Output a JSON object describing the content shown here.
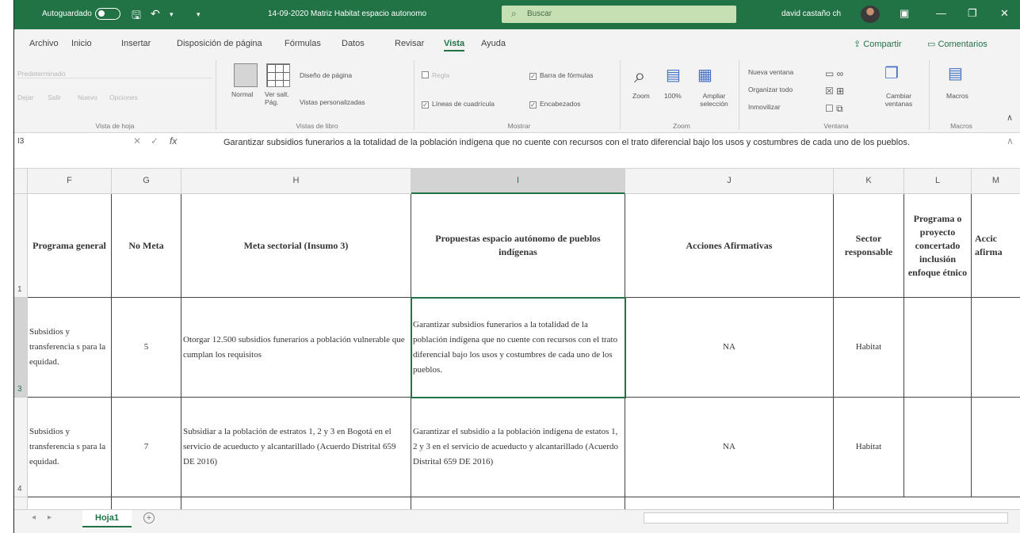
{
  "titlebar": {
    "autosave_label": "Autoguardado",
    "document_title": "14-09-2020 Matriz Habitat espacio autonomo",
    "search_placeholder": "Buscar",
    "user_name": "david castaño ch"
  },
  "tabs": [
    "Archivo",
    "Inicio",
    "Insertar",
    "Disposición de página",
    "Fórmulas",
    "Datos",
    "Revisar",
    "Vista",
    "Ayuda"
  ],
  "active_tab": "Vista",
  "share_label": "Compartir",
  "comments_label": "Comentarios",
  "ribbon": {
    "sheet_view": {
      "dropdown": "Predeterminado",
      "buttons": [
        "Dejar",
        "Salir",
        "Nuevo",
        "Opciones"
      ],
      "label": "Vista de hoja"
    },
    "workbook_views": {
      "normal": "Normal",
      "page_break": "Ver salt. Pág.",
      "page_layout": "Diseño de página",
      "custom": "Vistas personalizadas",
      "label": "Vistas de libro"
    },
    "show": {
      "ruler": "Regla",
      "formula_bar": "Barra de fórmulas",
      "gridlines": "Líneas de cuadrícula",
      "headings": "Encabezados",
      "label": "Mostrar"
    },
    "zoom": {
      "zoom": "Zoom",
      "hundred": "100%",
      "selection": "Ampliar selección",
      "label": "Zoom"
    },
    "window": {
      "new_window": "Nueva ventana",
      "arrange_all": "Organizar todo",
      "freeze": "Inmovilizar",
      "switch": "Cambiar ventanas",
      "label": "Ventana"
    },
    "macros": {
      "macros": "Macros",
      "label": "Macros"
    }
  },
  "formula_bar": {
    "name_box": "I3",
    "content": "Garantizar subsidios funerarios a la totalidad de la población indígena que no cuente con recursos con el trato diferencial bajo los usos y costumbres de cada uno de los pueblos."
  },
  "columns": [
    "F",
    "G",
    "H",
    "I",
    "J",
    "K",
    "L",
    "M"
  ],
  "rows": [
    "1",
    "3",
    "4"
  ],
  "header_row": {
    "F": "Programa general",
    "G": "No Meta",
    "H": "Meta sectorial (Insumo 3)",
    "I": "Propuestas espacio autónomo de pueblos indígenas",
    "J": "Acciones Afirmativas",
    "K": "Sector responsable",
    "L": "Programa o proyecto concertado inclusión enfoque étnico",
    "M": "Accic afirma"
  },
  "row3": {
    "F": "Subsidios y transferencia s para la equidad.",
    "G": "5",
    "H": "Otorgar 12.500 subsidios funerarios a población vulnerable que cumplan los requisitos",
    "I": "Garantizar subsidios funerarios a la totalidad de la población indígena que no cuente con recursos con el trato diferencial bajo los usos y costumbres de cada uno de los pueblos.",
    "J": "NA",
    "K": "Habitat"
  },
  "row4": {
    "F": "Subsidios y transferencia s para la equidad.",
    "G": "7",
    "H": "Subsidiar a la población de estratos 1, 2 y 3 en Bogotá en el servicio de acueducto y alcantarillado (Acuerdo Distrital 659 DE 2016)",
    "I": "Garantizar el subsidio a la población indígena de estatos 1, 2 y 3 en el servicio de acueducto y alcantarillado (Acuerdo Distrital 659 DE 2016)",
    "J": "NA",
    "K": "Habitat"
  },
  "sheet_tab": "Hoja1",
  "colors": {
    "excel_green": "#217346",
    "search_bg": "#c6e0b4"
  }
}
